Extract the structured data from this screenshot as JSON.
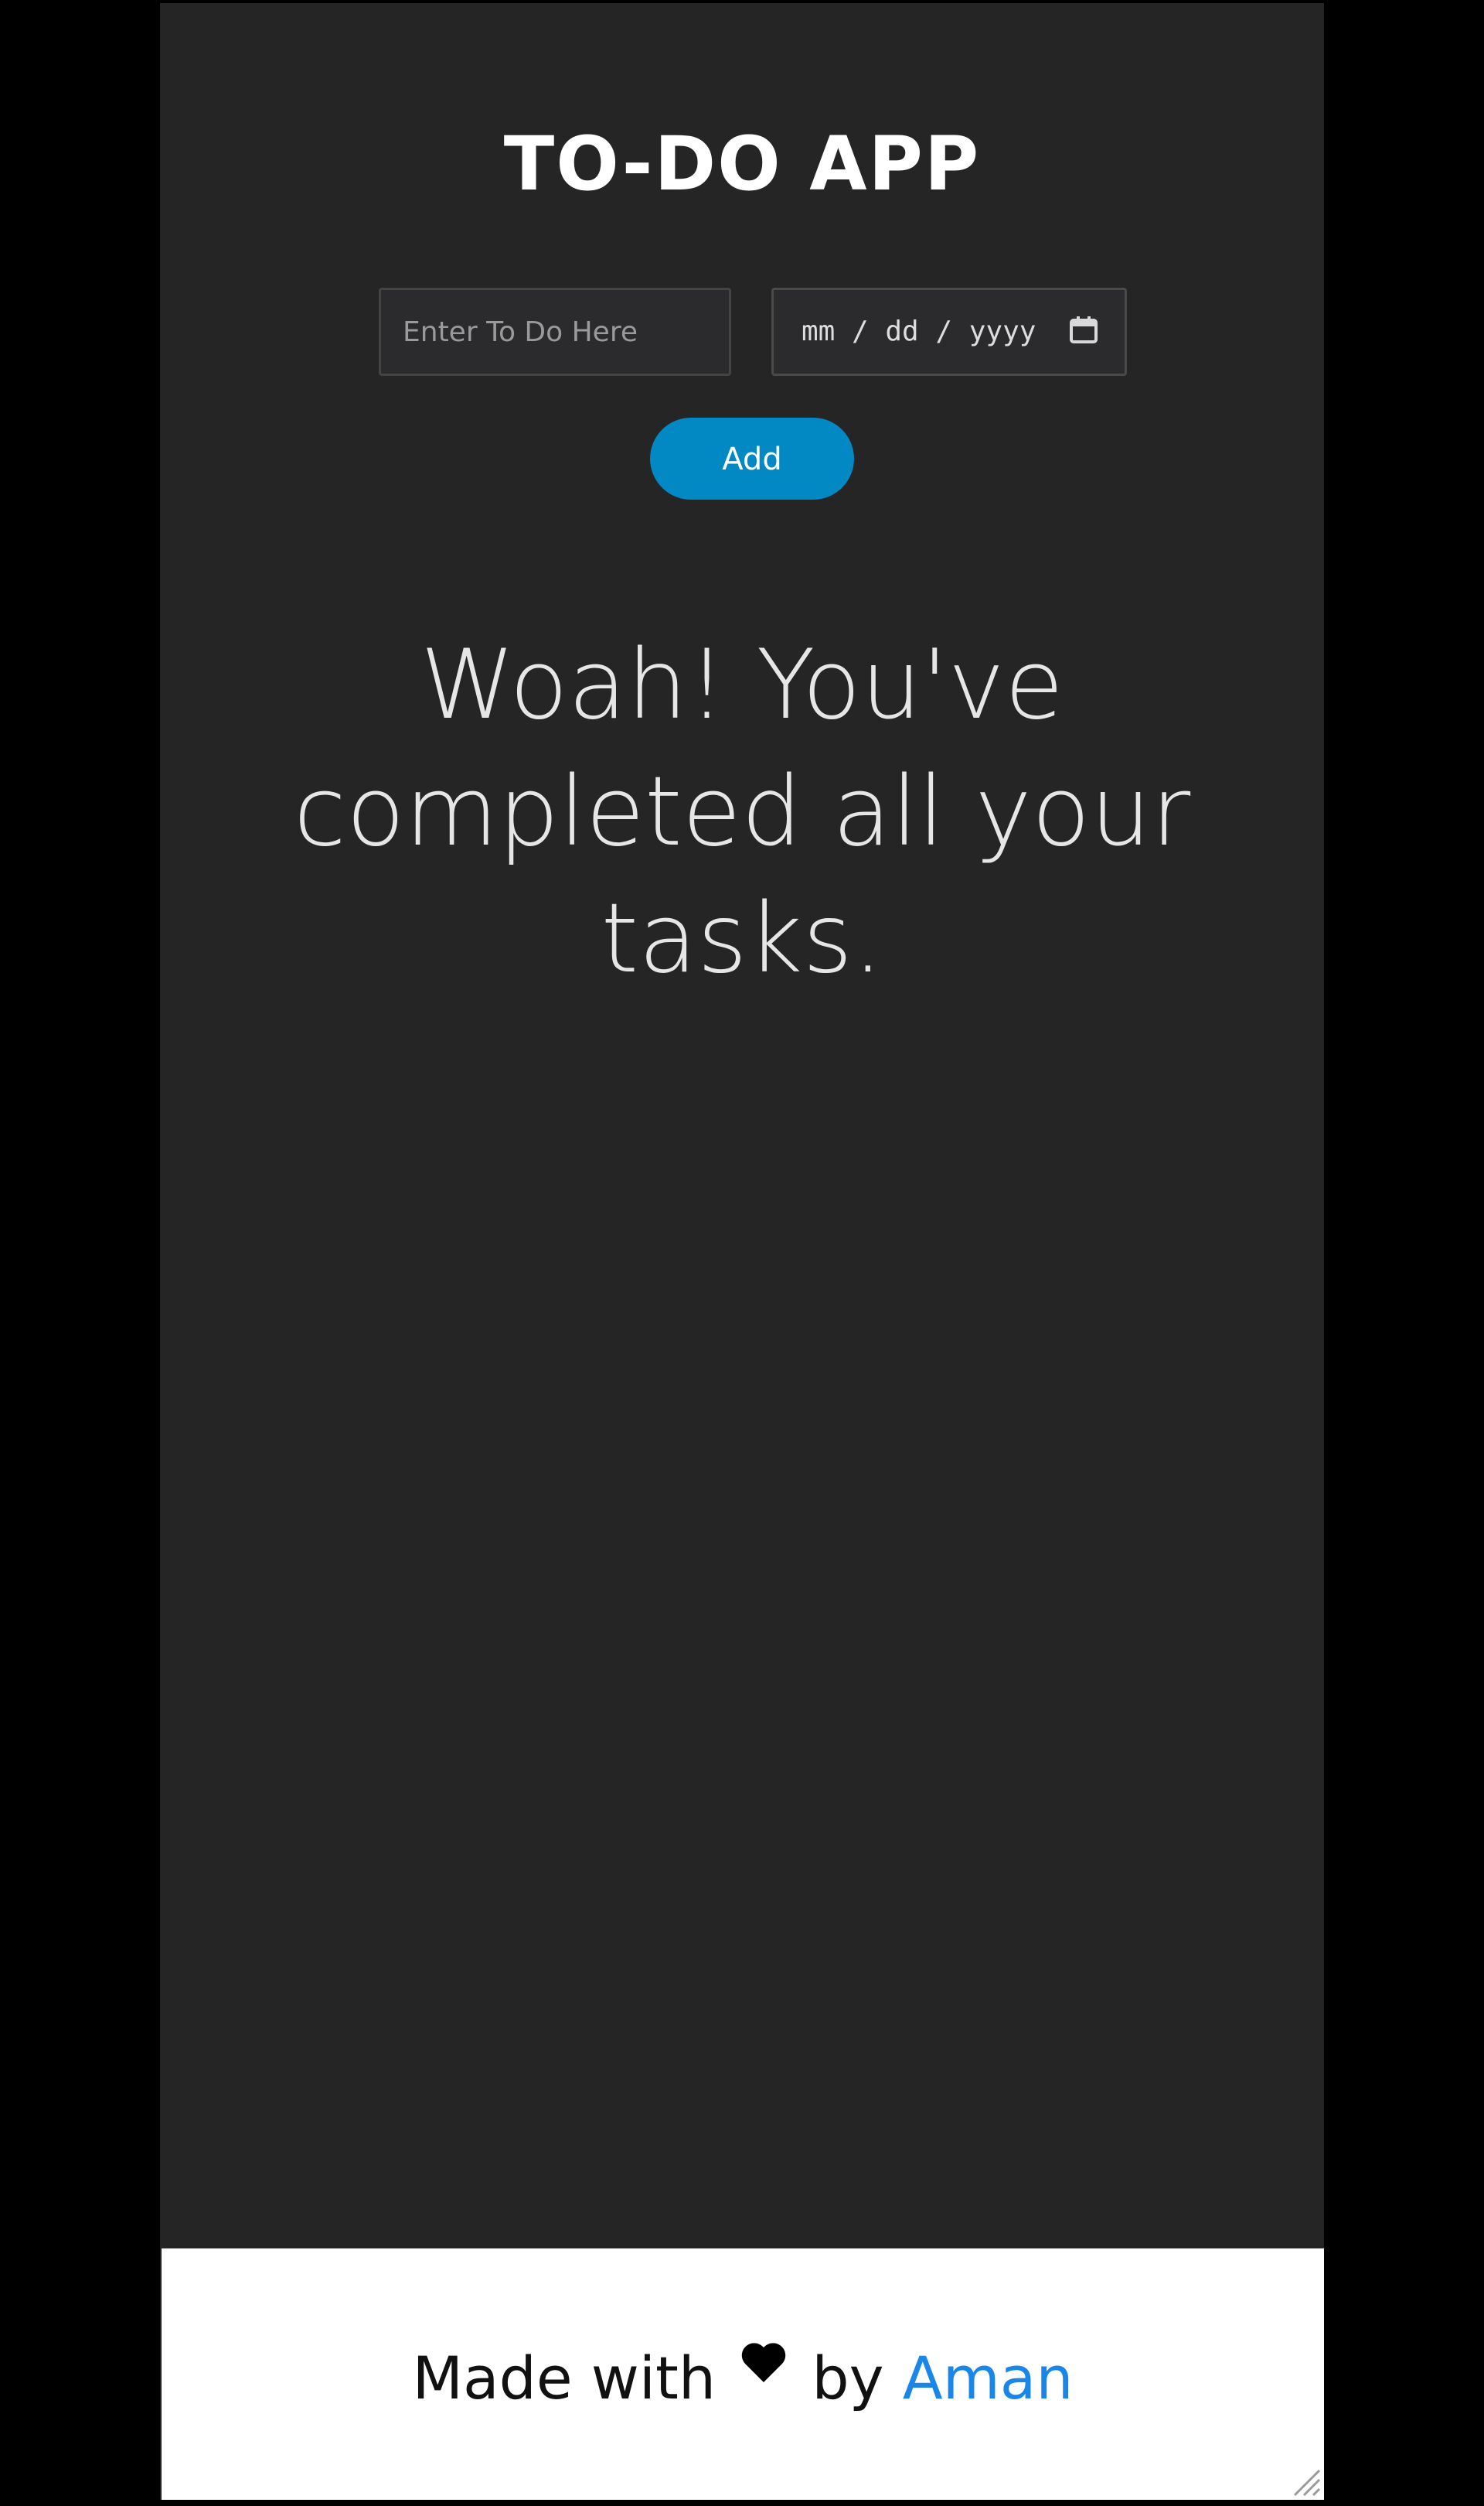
{
  "app": {
    "title": "TO-DO APP"
  },
  "form": {
    "todo_placeholder": "Enter To Do Here",
    "date_placeholder": "mm / dd / yyyy",
    "add_label": "Add"
  },
  "empty_state": {
    "message": "Woah! You've completed all your tasks."
  },
  "footer": {
    "prefix": "Made with",
    "middle": "by",
    "author": "Aman"
  },
  "icons": {
    "calendar": "calendar-icon",
    "heart": "heart-icon",
    "resize": "resize-grip-icon"
  },
  "colors": {
    "page_background": "#000000",
    "app_background": "#252525",
    "accent": "#0288c3",
    "link": "#1a86e8",
    "footer_background": "#ffffff"
  }
}
